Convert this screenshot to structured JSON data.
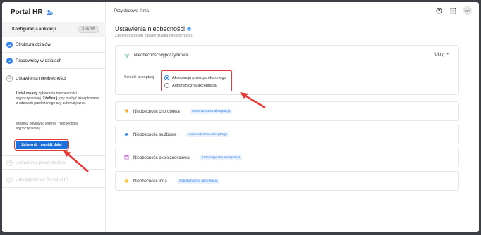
{
  "app": {
    "title": "Portal HR",
    "company": "Przykładowa firma",
    "avatar": "KP"
  },
  "sidebar": {
    "config_title": "Konfiguracja aplikacji",
    "step_badge": "Krok 3/5",
    "steps": [
      {
        "label": "Struktura działów",
        "state": "done"
      },
      {
        "label": "Pracownicy w działach",
        "state": "done"
      },
      {
        "label": "Ustawienia nieobecności",
        "state": "current",
        "num": "3"
      },
      {
        "label": "Ustawienia pracy zdalnej",
        "state": "disabled",
        "num": "4"
      },
      {
        "label": "Udostępnienie Portalu HR",
        "state": "disabled",
        "num": "5"
      }
    ],
    "desc_bold1": "Ustal zasady",
    "desc_text1": " zgłaszania nieobecności wypoczynkowej. ",
    "desc_bold2": "Zdefiniuj",
    "desc_text2": ", czy ma być akceptowana z udziałem przełożonego czy automatycznie.",
    "desc_note": "Możesz edytować jedynie \"nieobecność wypoczynkową\".",
    "button_label": "Zatwierdź i przejdź dalej"
  },
  "main": {
    "title": "Ustawienia nieobecności",
    "subtitle": "Zdefiniuj sposób zatwierdzania nieobecności.",
    "expanded": {
      "name": "Nieobecność wypoczynkowa",
      "toggle_label": "Ukryj",
      "path_label": "Ścieżki akceptacji",
      "options": [
        "Akceptacja przez przełożonego",
        "Automatyczna akceptacja"
      ],
      "selected": 0
    },
    "cards": [
      {
        "name": "Nieobecność chorobowa",
        "tag": "Automatyczna akceptacja",
        "icon": "heart-icon",
        "color": "#f5a623"
      },
      {
        "name": "Nieobecność służbowa",
        "tag": "Automatyczna akceptacja",
        "icon": "car-icon",
        "color": "#2f80ed"
      },
      {
        "name": "Nieobecność okolicznościowa",
        "tag": "Automatyczna akceptacja",
        "icon": "calendar-icon",
        "color": "#c86dd7"
      },
      {
        "name": "Nieobecność inna",
        "tag": "Automatyczna akceptacja",
        "icon": "bag-icon",
        "color": "#f2c94c"
      }
    ]
  },
  "colors": {
    "accent": "#2f80ed",
    "annotation": "#e53935",
    "leaf": "#27ae60"
  }
}
